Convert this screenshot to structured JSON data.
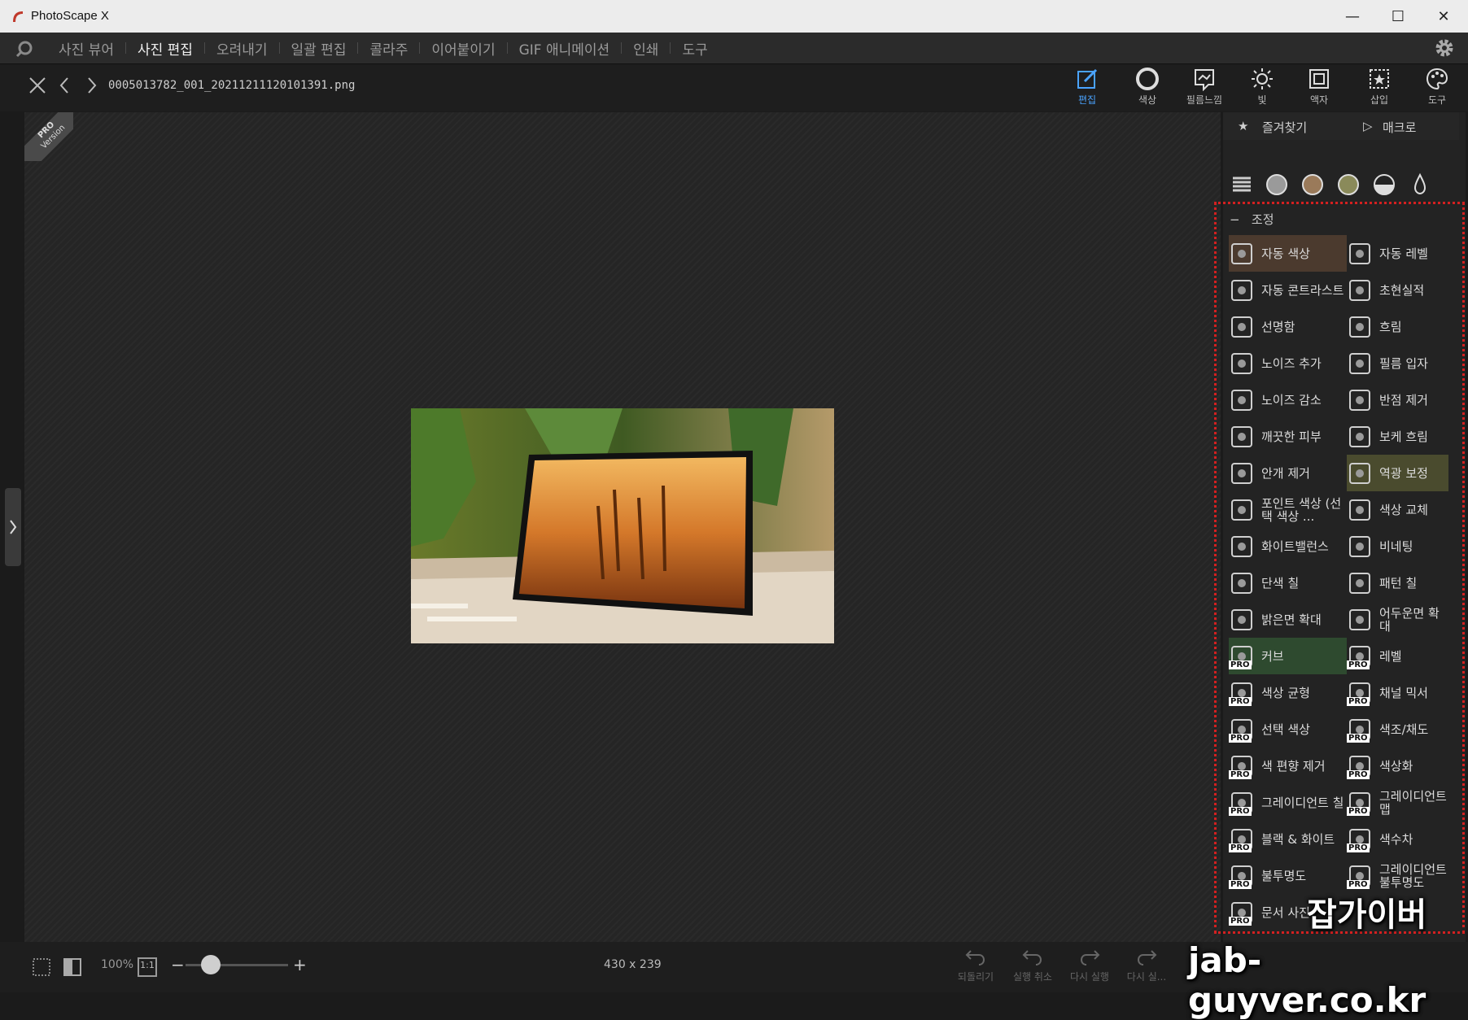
{
  "window": {
    "title": "PhotoScape X",
    "minimize": "—",
    "maximize": "☐",
    "close": "✕"
  },
  "menu": {
    "items": [
      "사진 뷰어",
      "사진 편집",
      "오려내기",
      "일괄 편집",
      "콜라주",
      "이어붙이기",
      "GIF 애니메이션",
      "인쇄",
      "도구"
    ],
    "active_index": 1
  },
  "file": {
    "name": "0005013782_001_20211211120101391.png"
  },
  "tools": {
    "edit": "편집",
    "color": "색상",
    "film": "필름느낌",
    "light": "빛",
    "frame": "액자",
    "insert": "삽입",
    "tool": "도구"
  },
  "ribbon": {
    "pro": "PRO",
    "version": "Version"
  },
  "panel": {
    "favorites": "즐겨찾기",
    "macro": "매크로",
    "adjust_title": "조정",
    "collapse": "−",
    "items": [
      {
        "label": "자동 색상",
        "icon": "auto-color-icon",
        "pro": false
      },
      {
        "label": "자동 레벨",
        "icon": "auto-level-icon",
        "pro": false
      },
      {
        "label": "자동 콘트라스트",
        "icon": "auto-contrast-icon",
        "pro": false
      },
      {
        "label": "초현실적",
        "icon": "surreal-icon",
        "pro": false
      },
      {
        "label": "선명함",
        "icon": "sharpen-icon",
        "pro": false
      },
      {
        "label": "흐림",
        "icon": "blur-icon",
        "pro": false
      },
      {
        "label": "노이즈 추가",
        "icon": "add-noise-icon",
        "pro": false
      },
      {
        "label": "필름 입자",
        "icon": "film-grain-icon",
        "pro": false
      },
      {
        "label": "노이즈 감소",
        "icon": "reduce-noise-icon",
        "pro": false
      },
      {
        "label": "반점 제거",
        "icon": "despeckle-icon",
        "pro": false
      },
      {
        "label": "깨끗한 피부",
        "icon": "clean-skin-icon",
        "pro": false
      },
      {
        "label": "보케 흐림",
        "icon": "bokeh-icon",
        "pro": false
      },
      {
        "label": "안개 제거",
        "icon": "dehaze-icon",
        "pro": false
      },
      {
        "label": "역광 보정",
        "icon": "backlight-icon",
        "pro": false
      },
      {
        "label": "포인트 색상 (선택 색상 ...",
        "icon": "point-color-icon",
        "pro": false
      },
      {
        "label": "색상 교체",
        "icon": "replace-color-icon",
        "pro": false
      },
      {
        "label": "화이트밸런스",
        "icon": "white-balance-icon",
        "pro": false
      },
      {
        "label": "비네팅",
        "icon": "vignette-icon",
        "pro": false
      },
      {
        "label": "단색 칠",
        "icon": "solid-fill-icon",
        "pro": false
      },
      {
        "label": "패턴 칠",
        "icon": "pattern-fill-icon",
        "pro": false
      },
      {
        "label": "밝은면 확대",
        "icon": "expand-light-icon",
        "pro": false
      },
      {
        "label": "어두운면 확대",
        "icon": "expand-dark-icon",
        "pro": false
      },
      {
        "label": "커브",
        "icon": "curves-icon",
        "pro": true
      },
      {
        "label": "레벨",
        "icon": "levels-icon",
        "pro": true
      },
      {
        "label": "색상 균형",
        "icon": "color-balance-icon",
        "pro": true
      },
      {
        "label": "채널 믹서",
        "icon": "channel-mixer-icon",
        "pro": true
      },
      {
        "label": "선택 색상",
        "icon": "selective-color-icon",
        "pro": true
      },
      {
        "label": "색조/채도",
        "icon": "hue-saturation-icon",
        "pro": true
      },
      {
        "label": "색 편향 제거",
        "icon": "remove-cast-icon",
        "pro": true
      },
      {
        "label": "색상화",
        "icon": "colorize-icon",
        "pro": true
      },
      {
        "label": "그레이디언트 칠",
        "icon": "gradient-fill-icon",
        "pro": true
      },
      {
        "label": "그레이디언트 맵",
        "icon": "gradient-map-icon",
        "pro": true
      },
      {
        "label": "블랙 & 화이트",
        "icon": "black-white-icon",
        "pro": true
      },
      {
        "label": "색수차",
        "icon": "chromatic-icon",
        "pro": true
      },
      {
        "label": "불투명도",
        "icon": "opacity-icon",
        "pro": true
      },
      {
        "label": "그레이디언트 불투명도",
        "icon": "gradient-opacity-icon",
        "pro": true
      },
      {
        "label": "문서 사진",
        "icon": "document-photo-icon",
        "pro": true
      },
      {
        "label": "",
        "icon": "",
        "pro": false
      }
    ]
  },
  "status": {
    "zoom": "100%",
    "ratio": "1:1",
    "minus": "−",
    "plus": "+",
    "dimensions": "430 x 239"
  },
  "history": {
    "first": "되돌리기",
    "undo": "실행 취소",
    "redo": "다시 실행",
    "redo_all": "다시 실..."
  },
  "watermark": {
    "korean": "잡가이버",
    "url": "jab-guyver.co.kr"
  },
  "colors": {
    "accent": "#4aa3ff",
    "highlight_box": "#d42020",
    "canvas": "#252525"
  }
}
